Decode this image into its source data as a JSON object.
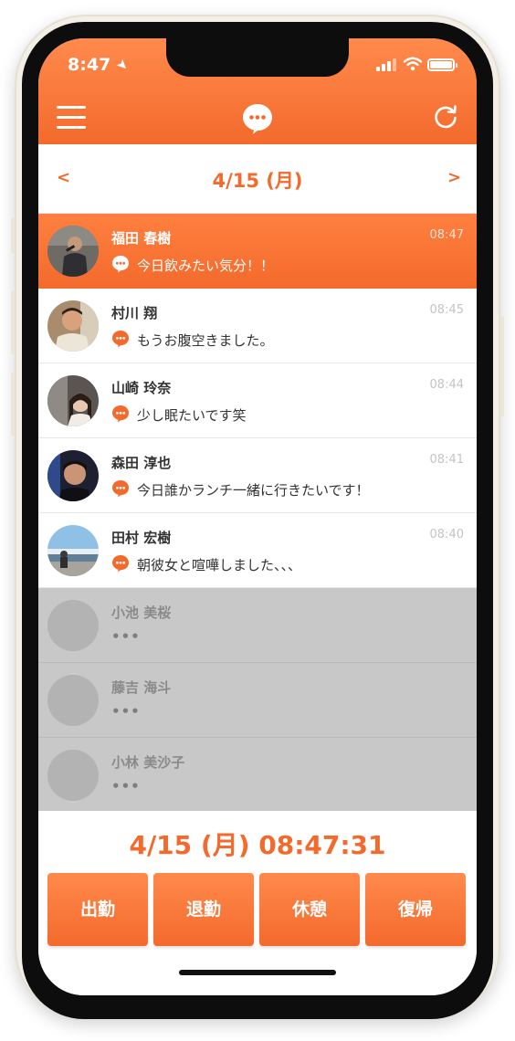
{
  "status_bar": {
    "time": "8:47"
  },
  "date_nav": {
    "prev": "<",
    "title": "4/15 (月)",
    "next": ">"
  },
  "messages": [
    {
      "name": "福田 春樹",
      "time": "08:47",
      "text": "今日飲みたい気分！！",
      "state": "active"
    },
    {
      "name": "村川 翔",
      "time": "08:45",
      "text": "もうお腹空きました。",
      "state": "normal"
    },
    {
      "name": "山崎 玲奈",
      "time": "08:44",
      "text": "少し眠たいです笑",
      "state": "normal"
    },
    {
      "name": "森田 淳也",
      "time": "08:41",
      "text": "今日誰かランチ一緒に行きたいです！",
      "state": "normal"
    },
    {
      "name": "田村 宏樹",
      "time": "08:40",
      "text": "朝彼女と喧嘩しました、、、",
      "state": "normal"
    },
    {
      "name": "小池 美桜",
      "text": "•••",
      "state": "inactive"
    },
    {
      "name": "藤吉 海斗",
      "text": "•••",
      "state": "inactive"
    },
    {
      "name": "小林 美沙子",
      "text": "•••",
      "state": "inactive"
    }
  ],
  "footer": {
    "clock": "4/15 (月) 08:47:31",
    "buttons": [
      "出勤",
      "退勤",
      "休憩",
      "復帰"
    ]
  },
  "colors": {
    "accent": "#f36a2c",
    "accent_light": "#ff8a4c",
    "inactive_row": "#c8c8c8"
  }
}
